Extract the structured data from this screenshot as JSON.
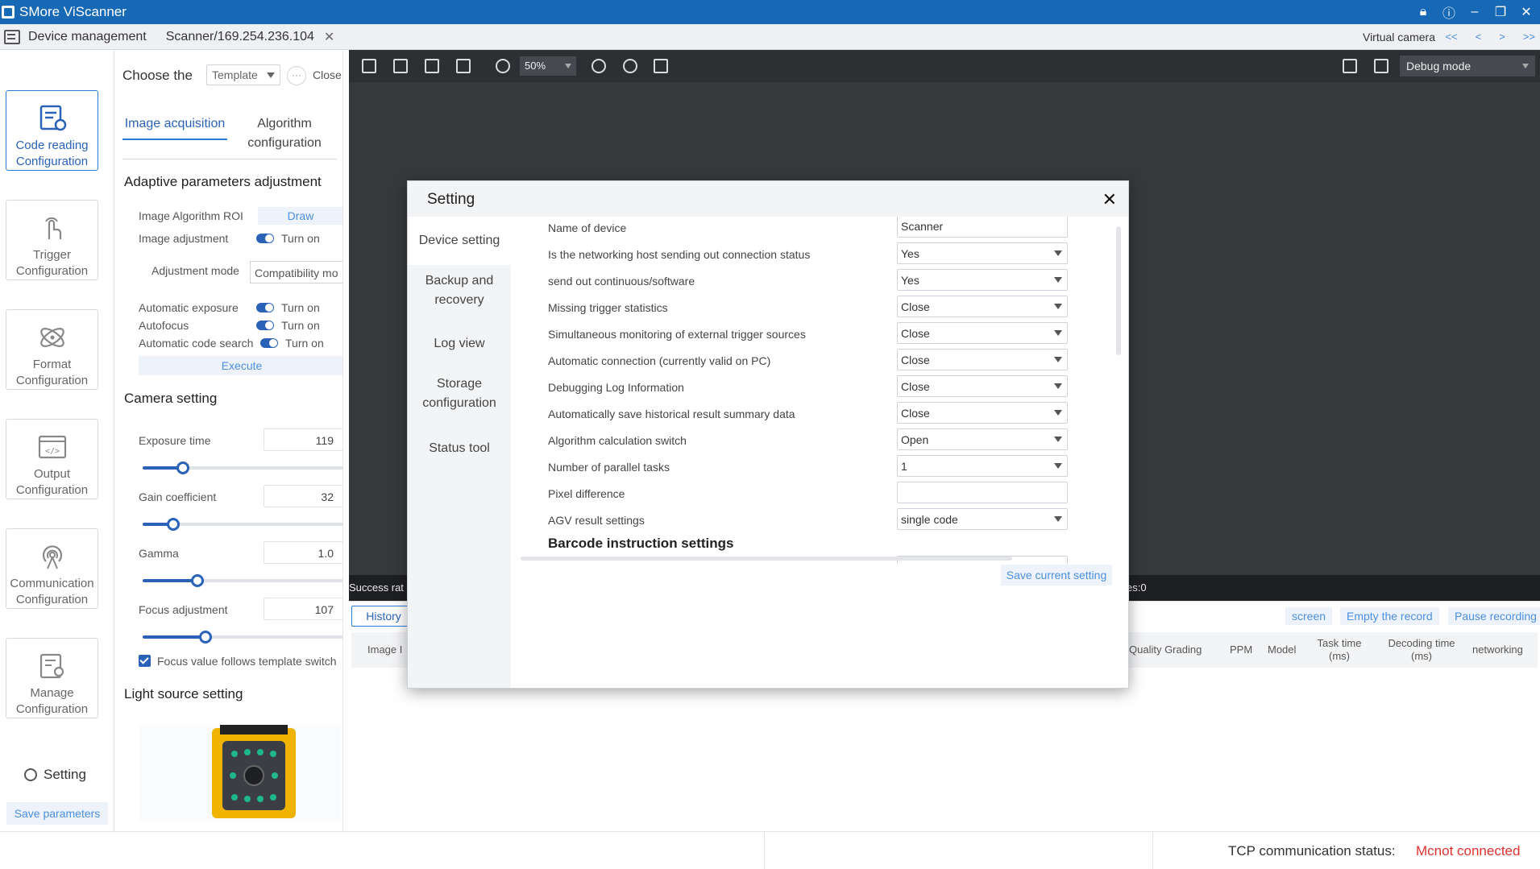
{
  "app": {
    "title": "SMore ViScanner",
    "window_controls": [
      "lock-icon",
      "info-icon",
      "minimize-icon",
      "restore-icon",
      "close-icon"
    ]
  },
  "tabs": {
    "device_management": "Device management",
    "scanner": "Scanner/169.254.236.104",
    "virtual_camera": "Virtual camera",
    "nav": [
      "<<",
      "<",
      ">",
      ">>"
    ]
  },
  "sidebar": {
    "items": [
      {
        "label": "Code reading Configuration",
        "icon": "code-reading-icon",
        "active": true
      },
      {
        "label": "Trigger Configuration",
        "icon": "trigger-icon",
        "active": false
      },
      {
        "label": "Format Configuration",
        "icon": "format-icon",
        "active": false
      },
      {
        "label": "Output Configuration",
        "icon": "output-icon",
        "active": false
      },
      {
        "label": "Communication Configuration",
        "icon": "communication-icon",
        "active": false
      },
      {
        "label": "Manage Configuration",
        "icon": "manage-icon",
        "active": false
      }
    ],
    "setting": "Setting",
    "save_parameters": "Save parameters"
  },
  "params": {
    "choose_label": "Choose the",
    "template_value": "Template",
    "close": "Close",
    "tabs": [
      "Image acquisition",
      "Algorithm configuration"
    ],
    "adaptive_title": "Adaptive parameters adjustment",
    "roi_label": "Image Algorithm ROI",
    "draw": "Draw",
    "image_adjustment": "Image adjustment",
    "turn_on": "Turn on",
    "adjustment_mode": "Adjustment mode",
    "adjustment_mode_value": "Compatibility mo",
    "auto_exposure": "Automatic exposure",
    "autofocus": "Autofocus",
    "auto_code_search": "Automatic code search",
    "execute": "Execute",
    "camera_title": "Camera setting",
    "exposure_time": "Exposure time",
    "exposure_value": "119",
    "gain": "Gain coefficient",
    "gain_value": "32",
    "gamma": "Gamma",
    "gamma_value": "1.0",
    "focus": "Focus adjustment",
    "focus_value": "107",
    "focus_follow": "Focus value follows template switch",
    "light_title": "Light source setting"
  },
  "toolbar": {
    "zoom": "50%",
    "mode": "Debug mode"
  },
  "viewer": {
    "success_rate": "Success rat",
    "es": "es:0"
  },
  "records": {
    "history": "History",
    "screen": "screen",
    "empty": "Empty the record",
    "pause": "Pause recording",
    "headers": [
      "Image I",
      "Quality Grading",
      "PPM",
      "Model",
      "Task time (ms)",
      "Decoding time (ms)",
      "networking"
    ]
  },
  "footer": {
    "tcp_label": "TCP communication status:",
    "tcp_value": "Mcnot connected"
  },
  "modal": {
    "title": "Setting",
    "side": [
      "Device setting",
      "Backup and recovery",
      "Log view",
      "Storage configuration",
      "Status tool"
    ],
    "fields": [
      {
        "label": "Name of device",
        "value": "Scanner"
      },
      {
        "label": "Is the networking host sending out connection status",
        "value": "Yes"
      },
      {
        "label": "send out continuous/software",
        "value": "Yes"
      },
      {
        "label": "Missing trigger statistics",
        "value": "Close"
      },
      {
        "label": "Simultaneous monitoring of external trigger sources",
        "value": "Close"
      },
      {
        "label": "Automatic connection (currently valid on PC)",
        "value": "Close"
      },
      {
        "label": "Debugging Log Information",
        "value": "Close"
      },
      {
        "label": "Automatically save historical result summary data",
        "value": "Close"
      },
      {
        "label": "Algorithm calculation switch",
        "value": "Open"
      },
      {
        "label": "Number of parallel tasks",
        "value": "1"
      },
      {
        "label": "Pixel difference",
        "value": ""
      },
      {
        "label": "AGV result settings",
        "value": "single code"
      }
    ],
    "barcode_section": "Barcode instruction settings",
    "save_current": "Save current setting"
  },
  "colors": {
    "brand": "#1769b5",
    "accent": "#2a62b8",
    "error": "#e03030"
  }
}
